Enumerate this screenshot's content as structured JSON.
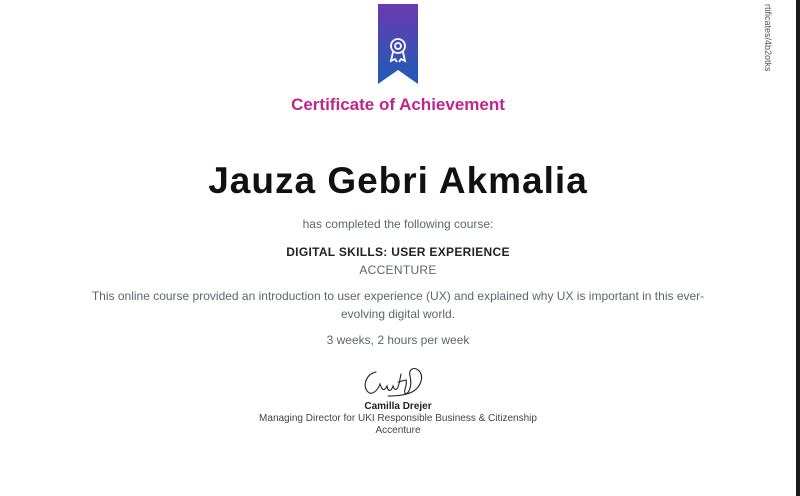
{
  "certificate": {
    "heading": "Certificate of Achievement",
    "learner_name": "Jauza Gebri Akmalia",
    "completed_text": "has completed the following course:",
    "course_title": "DIGITAL SKILLS: USER EXPERIENCE",
    "provider": "ACCENTURE",
    "description": "This online course provided an introduction to user experience (UX) and explained why UX is important in this ever-evolving digital world.",
    "duration": "3 weeks, 2 hours per week"
  },
  "signatory": {
    "name": "Camilla Drejer",
    "title": "Managing Director for UKI Responsible Business & Citizenship",
    "organization": "Accenture"
  },
  "side_url": "rtificates/4b2otks",
  "ribbon": {
    "icon": "award-badge-icon",
    "colors": [
      "#6a3bb0",
      "#1e5bb8"
    ]
  },
  "colors": {
    "heading": "#c1248b",
    "name": "#111111",
    "muted": "#5c6670"
  }
}
